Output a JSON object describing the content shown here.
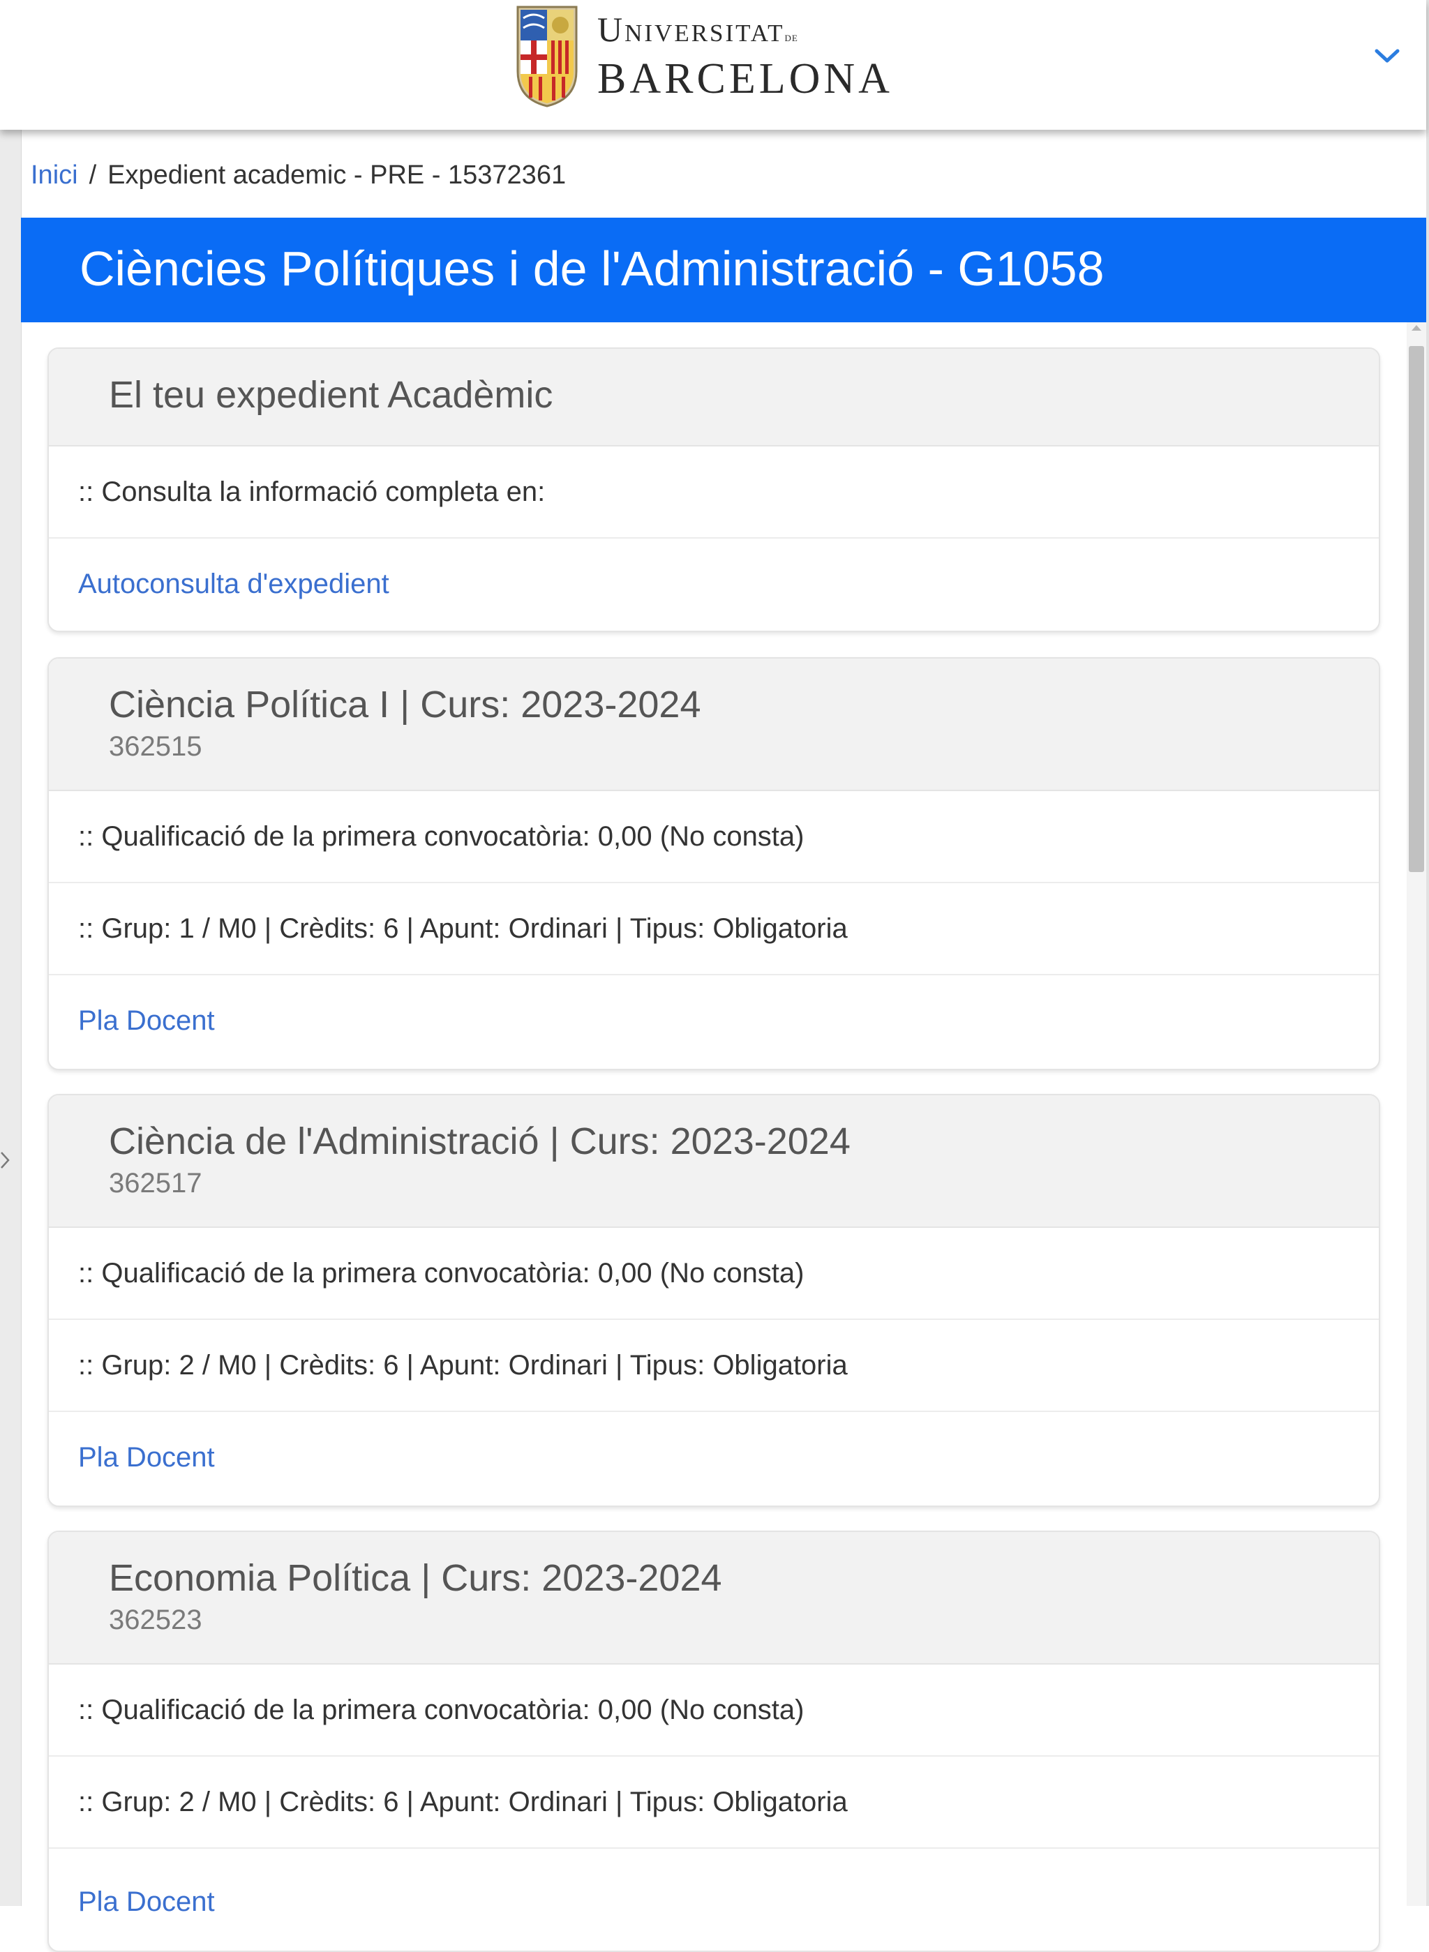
{
  "header": {
    "logo_line1": "Universitat",
    "logo_de": "de",
    "logo_line2": "BARCELONA",
    "logo_icon": "shield-icon",
    "toggle_icon": "chevron-down-icon"
  },
  "breadcrumb": {
    "home": "Inici",
    "separator": "/",
    "current": "Expedient academic - PRE - 15372361"
  },
  "banner": {
    "title": "Ciències Polítiques i de l'Administració - G1058"
  },
  "expedient": {
    "title": "El teu expedient Acadèmic",
    "info": ":: Consulta la informació completa en:",
    "link": "Autoconsulta d'expedient"
  },
  "subjects": [
    {
      "title": "Ciència Política I | Curs: 2023-2024",
      "code": "362515",
      "grade": ":: Qualificació de la primera convocatòria: 0,00 (No consta)",
      "details": ":: Grup: 1 / M0 | Crèdits: 6 | Apunt: Ordinari | Tipus: Obligatoria",
      "link": "Pla Docent"
    },
    {
      "title": "Ciència de l'Administració | Curs: 2023-2024",
      "code": "362517",
      "grade": ":: Qualificació de la primera convocatòria: 0,00 (No consta)",
      "details": ":: Grup: 2 / M0 | Crèdits: 6 | Apunt: Ordinari | Tipus: Obligatoria",
      "link": "Pla Docent"
    },
    {
      "title": "Economia Política | Curs: 2023-2024",
      "code": "362523",
      "grade": ":: Qualificació de la primera convocatòria: 0,00 (No consta)",
      "details": ":: Grup: 2 / M0 | Crèdits: 6 | Apunt: Ordinari | Tipus: Obligatoria",
      "link": "Pla Docent"
    }
  ],
  "colors": {
    "banner": "#0a6cf5",
    "link": "#3a6fcf",
    "card_header": "#f2f2f2"
  }
}
